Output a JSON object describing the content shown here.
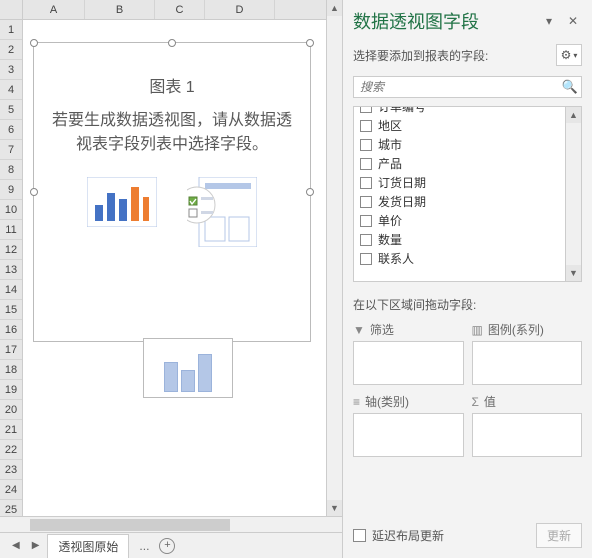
{
  "columns": [
    "A",
    "B",
    "C",
    "D"
  ],
  "rows_visible": 27,
  "chart": {
    "title": "图表 1",
    "message": "若要生成数据透视图，请从数据透视表字段列表中选择字段。"
  },
  "secondary_chart_bars": [
    30,
    22,
    38
  ],
  "sheet_tabs": {
    "active": "透视图原始",
    "dots": "..."
  },
  "pane": {
    "title": "数据透视图字段",
    "subtitle": "选择要添加到报表的字段:",
    "search_placeholder": "搜索",
    "fields": [
      "订单编号",
      "地区",
      "城市",
      "产品",
      "订货日期",
      "发货日期",
      "单价",
      "数量",
      "联系人"
    ],
    "drag_instruction": "在以下区域间拖动字段:",
    "zones": {
      "filter": "筛选",
      "legend": "图例(系列)",
      "axis": "轴(类别)",
      "values": "值"
    },
    "defer_label": "延迟布局更新",
    "update_label": "更新"
  }
}
